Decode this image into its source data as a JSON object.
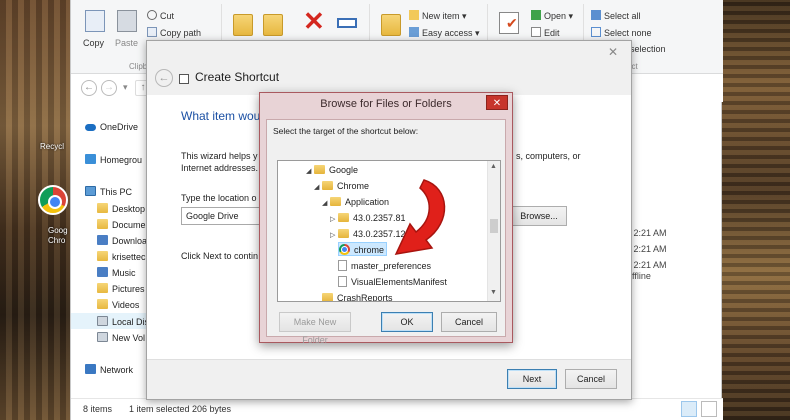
{
  "ribbon": {
    "copy": "Copy",
    "paste": "Paste",
    "cut": "Cut",
    "copy_path": "Copy path",
    "clipboard_group": "Clipb",
    "new_item": "New item",
    "easy_access": "Easy access",
    "open": "Open",
    "edit": "Edit",
    "select_all": "Select all",
    "select_none": "Select none",
    "invert_selection": "selection",
    "select_group": "ect"
  },
  "desktop": {
    "recycle": "Recycl",
    "google_chrome_1": "Goog",
    "google_chrome_2": "Chro"
  },
  "sidebar": {
    "items": [
      {
        "label": "OneDrive",
        "icon": "cloud-icon"
      },
      {
        "label": "Homegrou",
        "icon": "homegroup-icon"
      },
      {
        "label": "This PC",
        "icon": "pc-icon"
      },
      {
        "label": "Desktop",
        "icon": "folder-icon"
      },
      {
        "label": "Docume",
        "icon": "folder-icon"
      },
      {
        "label": "Downloa",
        "icon": "folder-icon"
      },
      {
        "label": "krisettec",
        "icon": "folder-icon"
      },
      {
        "label": "Music",
        "icon": "folder-icon"
      },
      {
        "label": "Pictures",
        "icon": "folder-icon"
      },
      {
        "label": "Videos",
        "icon": "folder-icon"
      },
      {
        "label": "Local Dis",
        "icon": "drive-icon"
      },
      {
        "label": "New Vol",
        "icon": "drive-icon"
      },
      {
        "label": "Network",
        "icon": "network-icon"
      }
    ]
  },
  "filelist_right": {
    "row1": "6 2:21 AM",
    "row2": "6 2:21 AM",
    "row3": "6 2:21 AM",
    "row4": "offline"
  },
  "status": {
    "count": "8 items",
    "selection": "1 item selected  206 bytes"
  },
  "wizard": {
    "title": "Create Shortcut",
    "heading": "What item wou",
    "desc_line1": "This wizard helps y",
    "desc_line1_tail": "s, computers, or",
    "desc_line2": "Internet addresses.",
    "location_label": "Type the location o",
    "location_value": "Google Drive",
    "browse_button": "Browse...",
    "continue_text": "Click Next to contin",
    "next_button": "Next",
    "cancel_button": "Cancel"
  },
  "browse_dialog": {
    "title": "Browse for Files or Folders",
    "prompt": "Select the target of the shortcut below:",
    "tree": [
      {
        "label": "Google",
        "indent": 1,
        "type": "folder",
        "expander": "open"
      },
      {
        "label": "Chrome",
        "indent": 2,
        "type": "folder",
        "expander": "open"
      },
      {
        "label": "Application",
        "indent": 3,
        "type": "folder",
        "expander": "open"
      },
      {
        "label": "43.0.2357.81",
        "indent": 4,
        "type": "folder",
        "expander": "closed"
      },
      {
        "label": "43.0.2357.124",
        "indent": 4,
        "type": "folder",
        "expander": "closed"
      },
      {
        "label": "chrome",
        "indent": 4,
        "type": "chrome",
        "expander": "none",
        "selected": true
      },
      {
        "label": "master_preferences",
        "indent": 4,
        "type": "file",
        "expander": "none"
      },
      {
        "label": "VisualElementsManifest",
        "indent": 4,
        "type": "file",
        "expander": "none"
      },
      {
        "label": "CrashReports",
        "indent": 2,
        "type": "folder",
        "expander": "none"
      }
    ],
    "make_new_folder": "Make New Folder",
    "ok": "OK",
    "cancel": "Cancel"
  },
  "colors": {
    "dialog_frame": "#e8d3d6",
    "close_red": "#c7352c",
    "link_blue": "#1b50a4",
    "arrow_red": "#e0201a"
  }
}
